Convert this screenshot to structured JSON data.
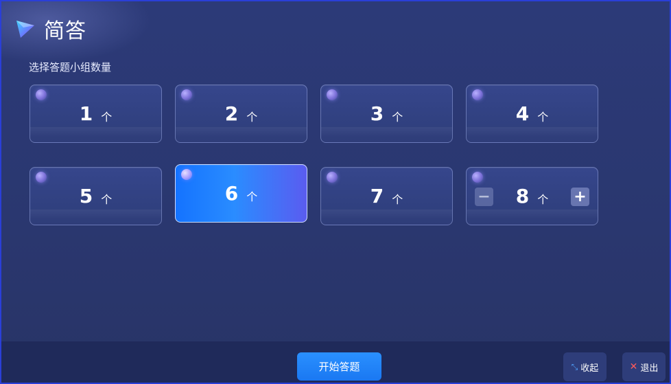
{
  "header": {
    "title": "简答",
    "subtitle": "选择答题小组数量",
    "logo_icon": "play-triangle-logo-icon"
  },
  "groups": {
    "unit": "个",
    "selected": 6,
    "options": [
      {
        "num": "1",
        "unit": "个"
      },
      {
        "num": "2",
        "unit": "个"
      },
      {
        "num": "3",
        "unit": "个"
      },
      {
        "num": "4",
        "unit": "个"
      },
      {
        "num": "5",
        "unit": "个"
      },
      {
        "num": "6",
        "unit": "个"
      },
      {
        "num": "7",
        "unit": "个"
      },
      {
        "num": "8",
        "unit": "个"
      }
    ],
    "stepper": {
      "minus_label": "−",
      "plus_label": "+"
    }
  },
  "footer": {
    "start_label": "开始答题",
    "collapse_label": "收起",
    "exit_label": "退出",
    "collapse_icon": "shrink-arrows-icon",
    "exit_icon": "close-x-icon"
  },
  "colors": {
    "background": "#2c3a78",
    "selected_card": "#1473ff",
    "accent": "#2a90ff",
    "exit_icon": "#ff5a5a"
  }
}
